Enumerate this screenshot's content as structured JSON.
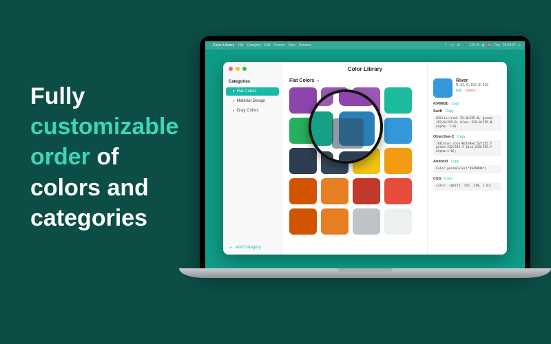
{
  "headline": {
    "l1": "Fully",
    "l2": "customizable",
    "l3": "order",
    "l4": " of",
    "l5": "colors and",
    "l6": "categories"
  },
  "menubar": {
    "app": "Color Library",
    "items": [
      "File",
      "Category",
      "Edit",
      "Format",
      "View",
      "Window"
    ],
    "right": {
      "batt": "100 %",
      "flag": "🇺🇸",
      "day": "Thu",
      "time": "23:38:37"
    }
  },
  "window": {
    "title": "Color Library"
  },
  "sidebar": {
    "heading": "Categories",
    "items": [
      {
        "label": "Flat Colors",
        "selected": true
      },
      {
        "label": "Material Design",
        "selected": false
      },
      {
        "label": "Gray Colors",
        "selected": false
      }
    ],
    "add": "Add Category"
  },
  "main": {
    "category_label": "Flat Colors",
    "swatches": [
      "#8e44ad",
      "#9b59b6",
      "#9b59b6",
      "#1abc9c",
      "#27ae60",
      "#16a085",
      "#2980b9",
      "#3498db",
      "#2c3e50",
      "#34495e",
      "#f1c40f",
      "#f39c12",
      "#d35400",
      "#e67e22",
      "#c0392b",
      "#e74c3c",
      "#d35400",
      "#e67e22",
      "#bdc3c7",
      "#ecf0f1"
    ]
  },
  "detail": {
    "name": "River",
    "rgb": "R: 52, G: 152, B: 219",
    "edit": "Edit",
    "delete": "Delete",
    "hex_label": "#3498db",
    "copy": "Copy",
    "swift": {
      "title": "Swift",
      "code": "UIColor(red: 52.0/255.0, green: 152.0/255.0, blue: 219.0/255.0, alpha: 1.0)"
    },
    "objc": {
      "title": "Objective-C",
      "code": "[UIColor colorWithRed:52/255.f green:152/255.f blue:219/255.f alpha:1.0];"
    },
    "android": {
      "title": "Android",
      "code": "Color.parseColor(\"#3498db\")"
    },
    "css": {
      "title": "CSS",
      "code": "color: rgb(52, 152, 219, 1.0);"
    }
  },
  "magnifier": {
    "cells": [
      "#9b59b6",
      "#8e44ad",
      "#3498db",
      "#16a085",
      "#2980b9",
      "#3498db",
      "#34495e",
      "#2c3e50",
      "#f1c40f"
    ]
  }
}
